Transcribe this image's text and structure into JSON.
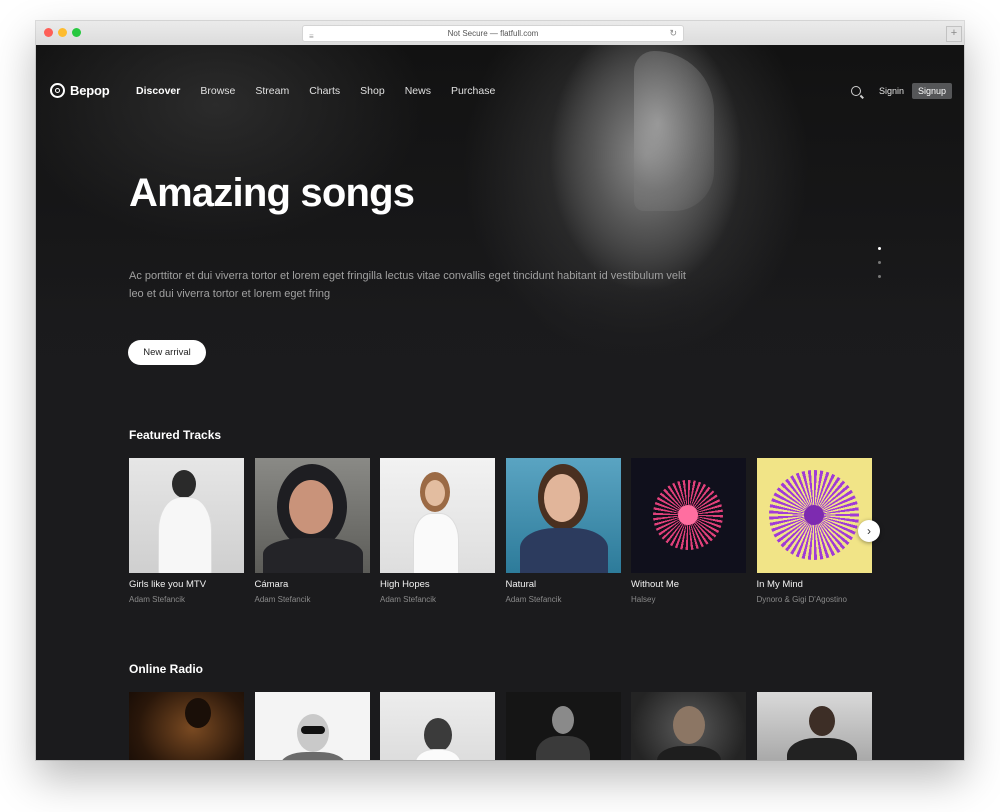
{
  "browser": {
    "url": "Not Secure — flatfull.com",
    "lines_icon": "≡",
    "reload_icon": "↻",
    "newtab_icon": "+"
  },
  "brand": {
    "name": "Bepop"
  },
  "nav": {
    "items": [
      "Discover",
      "Browse",
      "Stream",
      "Charts",
      "Shop",
      "News",
      "Purchase"
    ],
    "signin": "Signin",
    "signup": "Signup"
  },
  "hero": {
    "title": "Amazing songs",
    "description": "Ac porttitor et dui viverra tortor et lorem eget fringilla lectus vitae convallis eget tincidunt habitant id vestibulum velit leo et dui viverra tortor et lorem eget fring",
    "button": "New arrival"
  },
  "featured": {
    "title": "Featured Tracks",
    "next_icon": "›",
    "tracks": [
      {
        "title": "Girls like you MTV",
        "artist": "Adam Stefancik"
      },
      {
        "title": "Cámara",
        "artist": "Adam Stefancik"
      },
      {
        "title": "High Hopes",
        "artist": "Adam Stefancik"
      },
      {
        "title": "Natural",
        "artist": "Adam Stefancik"
      },
      {
        "title": "Without Me",
        "artist": "Halsey"
      },
      {
        "title": "In My Mind",
        "artist": "Dynoro & Gigi D'Agostino"
      }
    ]
  },
  "radio": {
    "title": "Online Radio"
  },
  "colors": {
    "page_bg": "#1b1b1d",
    "signup_bg": "#555658",
    "accent_pink": "#e0407a",
    "accent_purple": "#a13bd6"
  }
}
